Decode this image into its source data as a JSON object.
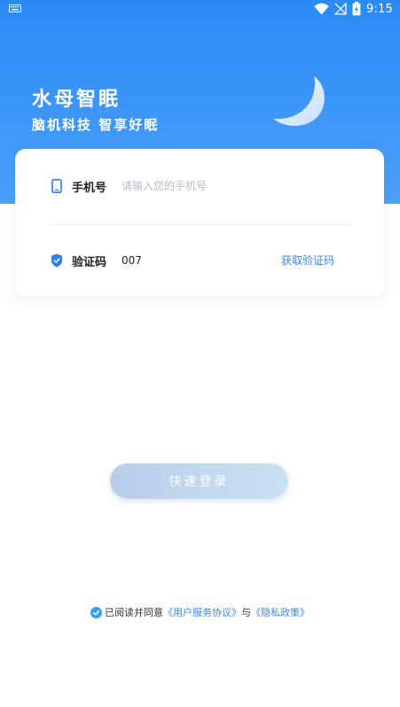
{
  "status_bar": {
    "time": "9:15"
  },
  "brand": {
    "title": "水母智眠",
    "subtitle": "脑机科技 智享好眠"
  },
  "form": {
    "phone": {
      "label": "手机号",
      "placeholder": "请输入您的手机号",
      "value": ""
    },
    "code": {
      "label": "验证码",
      "value": "007",
      "get_code_label": "获取验证码"
    }
  },
  "login_button": {
    "label": "快速登录"
  },
  "agreement": {
    "prefix": "已阅读并同意",
    "user_agreement": "《用户服务协议》",
    "conjunction": "与",
    "privacy_policy": "《隐私政策》",
    "checked": true
  },
  "colors": {
    "brand_blue": "#2a8bf6",
    "link_blue": "#3a86f2",
    "button_gradient_start": "#b9cde9",
    "button_gradient_end": "#c7e2f2"
  },
  "icons": {
    "status_left": "keyboard-icon",
    "wifi": "wifi-icon",
    "signal": "no-signal-icon",
    "battery": "battery-icon",
    "phone_field": "phone-icon",
    "code_field": "shield-check-icon",
    "moon": "moon-icon",
    "agreement": "check-circle-icon"
  }
}
